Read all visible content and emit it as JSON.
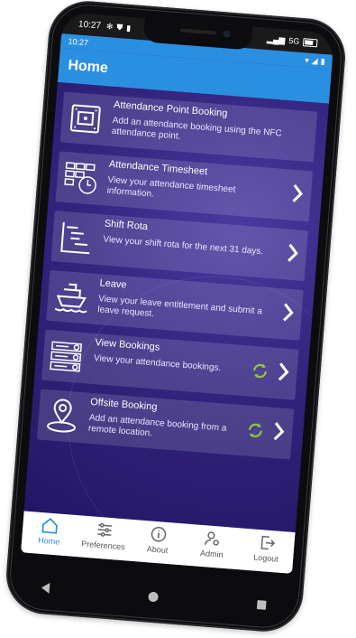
{
  "status": {
    "time": "10:27",
    "network": "5G"
  },
  "header": {
    "title": "Home"
  },
  "menu": [
    {
      "key": "attendance-point-booking",
      "title": "Attendance Point Booking",
      "desc": "Add an attendance booking using the NFC attendance point.",
      "chevron": false,
      "sync": false
    },
    {
      "key": "attendance-timesheet",
      "title": "Attendance Timesheet",
      "desc": "View your attendance timesheet information.",
      "chevron": true,
      "sync": false
    },
    {
      "key": "shift-rota",
      "title": "Shift Rota",
      "desc": "View your shift rota for the next 31 days.",
      "chevron": true,
      "sync": false
    },
    {
      "key": "leave",
      "title": "Leave",
      "desc": "View your leave entitlement and submit a leave request.",
      "chevron": true,
      "sync": false
    },
    {
      "key": "view-bookings",
      "title": "View Bookings",
      "desc": "View your attendance bookings.",
      "chevron": true,
      "sync": true
    },
    {
      "key": "offsite-booking",
      "title": "Offsite Booking",
      "desc": "Add an attendance booking from a remote location.",
      "chevron": true,
      "sync": true
    }
  ],
  "nav": [
    {
      "label": "Home",
      "active": true
    },
    {
      "label": "Preferences",
      "active": false
    },
    {
      "label": "About",
      "active": false
    },
    {
      "label": "Admin",
      "active": false
    },
    {
      "label": "Logout",
      "active": false
    }
  ],
  "colors": {
    "accent": "#2b8fe0",
    "background": "#2c1f6e",
    "sync": "#8cc63f"
  }
}
